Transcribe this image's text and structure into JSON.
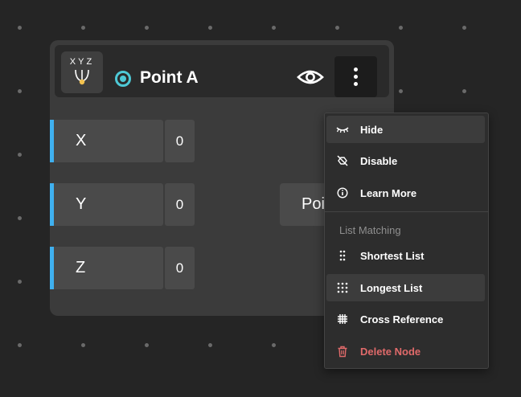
{
  "node": {
    "icon_text": "XYZ",
    "title": "Point A",
    "status_color": "#4ec9d6",
    "visibility_icon": "eye-icon",
    "more_icon": "more-vertical-icon",
    "inputs": [
      {
        "label": "X",
        "value": "0"
      },
      {
        "label": "Y",
        "value": "0"
      },
      {
        "label": "Z",
        "value": "0"
      }
    ],
    "output": {
      "label": "Point"
    }
  },
  "context_menu": {
    "items": [
      {
        "label": "Hide",
        "icon": "eye-closed-icon"
      },
      {
        "label": "Disable",
        "icon": "disable-icon"
      },
      {
        "label": "Learn More",
        "icon": "info-icon"
      }
    ],
    "section_label": "List Matching",
    "matching_items": [
      {
        "label": "Shortest List",
        "icon": "shortest-list-icon"
      },
      {
        "label": "Longest List",
        "icon": "longest-list-icon"
      },
      {
        "label": "Cross Reference",
        "icon": "cross-reference-icon"
      }
    ],
    "delete": {
      "label": "Delete Node",
      "icon": "trash-icon",
      "color": "#e06a6a"
    }
  },
  "colors": {
    "canvas": "#252525",
    "node_body": "#3b3b3b",
    "port_accent": "#3fb0ef",
    "menu_bg": "#2d2d2d"
  }
}
